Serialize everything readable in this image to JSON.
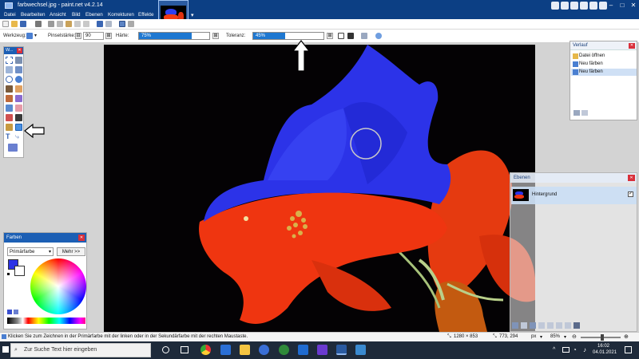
{
  "window": {
    "title": "farbwechsel.jpg - paint.net v4.2.14"
  },
  "menu": {
    "items": [
      "Datei",
      "Bearbeiten",
      "Ansicht",
      "Bild",
      "Ebenen",
      "Korrekturen",
      "Effekte"
    ]
  },
  "toolbar": {
    "werkzeug_label": "Werkzeug:",
    "pinselstaerke_label": "Pinselstärke:",
    "pinselstaerke_value": "90",
    "haerte_label": "Härte:",
    "haerte_value": "75%",
    "haerte_percent": 75,
    "toleranz_label": "Toleranz:",
    "toleranz_value": "45%",
    "toleranz_percent": 45
  },
  "tools_window": {
    "title": "W..."
  },
  "colors_window": {
    "title": "Farben",
    "mode_select": "Primärfarbe",
    "more_button": "Mehr >>",
    "primary_color": "#2c33e6",
    "secondary_color": "#ffffff"
  },
  "history_window": {
    "title": "Verlauf",
    "items": [
      {
        "label": "Datei öffnen"
      },
      {
        "label": "Neu färben"
      },
      {
        "label": "Neu färben"
      }
    ]
  },
  "layers_window": {
    "title": "Ebenen",
    "layer_name": "Hintergrund"
  },
  "status": {
    "hint": "Klicken Sie zum Zeichnen in der Primärfarbe mit der linken oder in der Sekundärfarbe mit der rechten Maustaste.",
    "image_size": "1280 × 853",
    "cursor_pos": "773, 294",
    "unit": "px",
    "zoom": "85%"
  },
  "taskbar": {
    "search_placeholder": "Zur Suche Text hier eingeben",
    "time": "16:02",
    "date": "04.01.2021"
  },
  "colors": {
    "accent": "#1c5fb4",
    "title_bar": "#0c3f84"
  }
}
